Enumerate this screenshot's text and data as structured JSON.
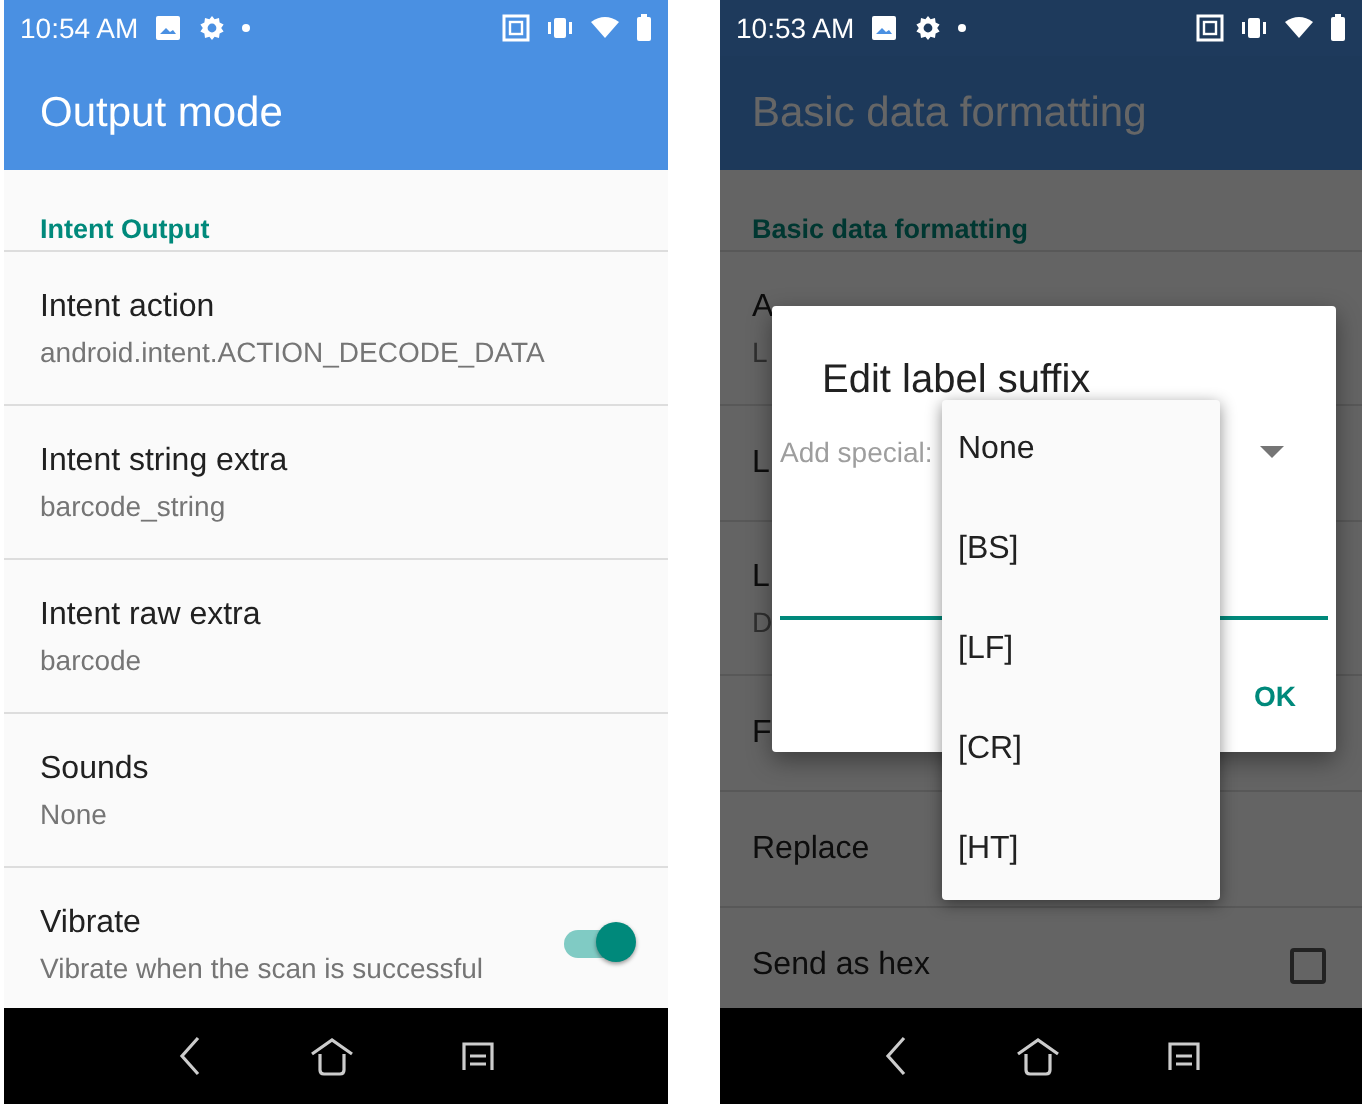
{
  "phones": [
    {
      "status_bar": {
        "time": "10:54 AM"
      },
      "app_bar": {
        "title": "Output mode"
      },
      "dimmed": false,
      "category": "Intent Output",
      "preferences": [
        {
          "kind": "text",
          "title": "Intent action",
          "summary": "android.intent.ACTION_DECODE_DATA"
        },
        {
          "kind": "text",
          "title": "Intent string extra",
          "summary": "barcode_string"
        },
        {
          "kind": "text",
          "title": "Intent raw extra",
          "summary": "barcode"
        },
        {
          "kind": "text",
          "title": "Sounds",
          "summary": "None"
        },
        {
          "kind": "switch",
          "title": "Vibrate",
          "summary": "Vibrate when the scan is successful",
          "on": true
        }
      ]
    },
    {
      "status_bar": {
        "time": "10:53 AM"
      },
      "app_bar": {
        "title": "Basic data formatting"
      },
      "dimmed": true,
      "category": "Basic data formatting",
      "preferences": [
        {
          "kind": "text",
          "title": "A",
          "summary": "L"
        },
        {
          "kind": "text",
          "title": "L"
        },
        {
          "kind": "text",
          "title": "L",
          "summary": "D"
        },
        {
          "kind": "text",
          "title": "F"
        },
        {
          "kind": "text",
          "title": "Replace"
        },
        {
          "kind": "checkbox",
          "title": "Send as hex",
          "checked": false
        }
      ],
      "dialog": {
        "title": "Edit label suffix",
        "label": "Add special:",
        "button": "OK",
        "dropdown": [
          "None",
          "[BS]",
          "[LF]",
          "[CR]",
          "[HT]"
        ]
      }
    }
  ]
}
